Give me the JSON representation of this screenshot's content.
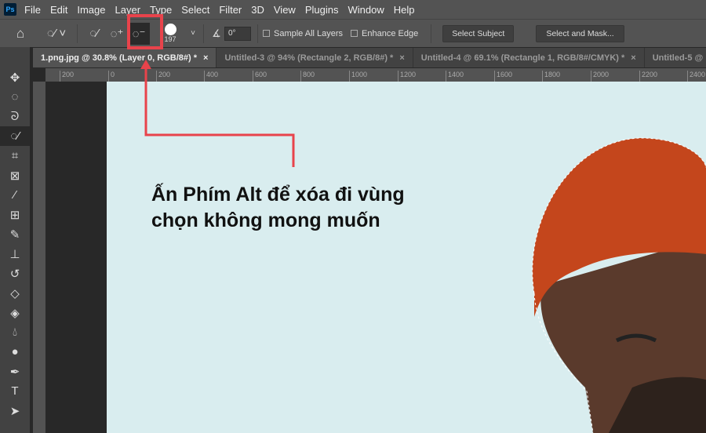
{
  "app": {
    "logo": "Ps"
  },
  "menu": [
    "File",
    "Edit",
    "Image",
    "Layer",
    "Type",
    "Select",
    "Filter",
    "3D",
    "View",
    "Plugins",
    "Window",
    "Help"
  ],
  "options": {
    "brush_size": "197",
    "angle": "0°",
    "sample_all_layers": "Sample All Layers",
    "enhance_edge": "Enhance Edge",
    "select_subject": "Select Subject",
    "select_and_mask": "Select and Mask..."
  },
  "tabs": [
    {
      "label": "1.png.jpg @ 30.8% (Layer 0, RGB/8#) *",
      "close": "×"
    },
    {
      "label": "Untitled-3 @ 94% (Rectangle 2, RGB/8#) *",
      "close": "×"
    },
    {
      "label": "Untitled-4 @ 69.1% (Rectangle 1, RGB/8#/CMYK) *",
      "close": "×"
    },
    {
      "label": "Untitled-5 @"
    }
  ],
  "ruler": [
    "200",
    "0",
    "200",
    "400",
    "600",
    "800",
    "1000",
    "1200",
    "1400",
    "1600",
    "1800",
    "2000",
    "2200",
    "2400"
  ],
  "caption": {
    "line1": "Ấn Phím Alt để xóa đi vùng",
    "line2": "chọn không mong muốn"
  },
  "colors": {
    "highlight": "#e8434b",
    "beanie": "#c4461c"
  }
}
